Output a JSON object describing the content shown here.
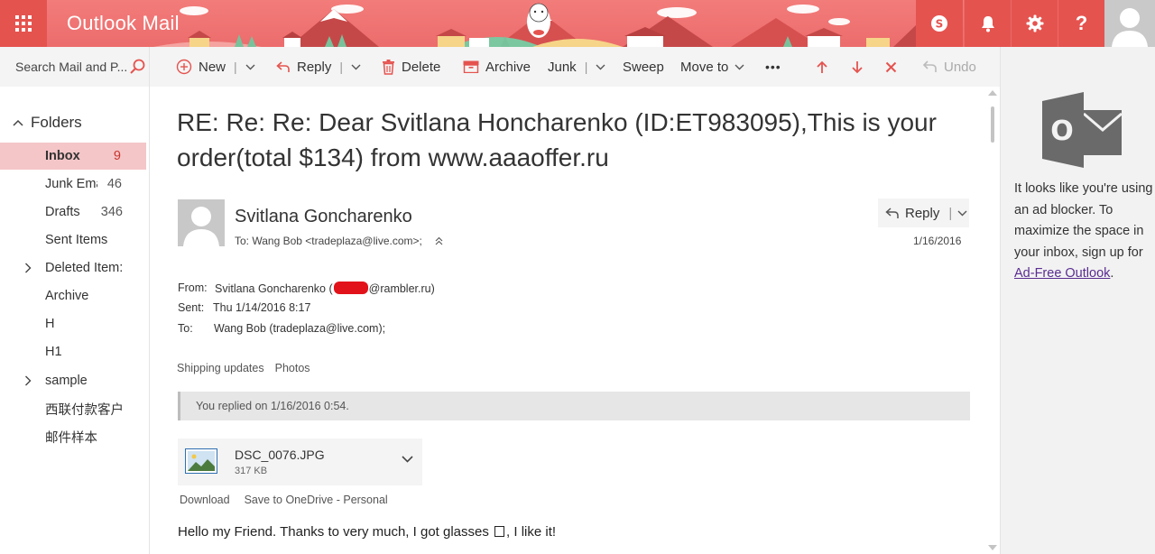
{
  "header": {
    "app_title": "Outlook Mail",
    "brand_color": "#ec6c6c",
    "buttons": [
      "skype-icon",
      "bell-icon",
      "gear-icon",
      "help-icon"
    ],
    "help_glyph": "?"
  },
  "search": {
    "placeholder": "Search Mail and P..."
  },
  "toolbar": {
    "new_label": "New",
    "reply_label": "Reply",
    "delete_label": "Delete",
    "archive_label": "Archive",
    "junk_label": "Junk",
    "sweep_label": "Sweep",
    "move_to_label": "Move to",
    "more_glyph": "•••",
    "undo_label": "Undo",
    "separator": "|"
  },
  "nav": {
    "folders_label": "Folders",
    "folders": [
      {
        "name": "Inbox",
        "count": "9",
        "selected": true
      },
      {
        "name": "Junk Ema",
        "count": "46"
      },
      {
        "name": "Drafts",
        "count": "346"
      },
      {
        "name": "Sent Items",
        "count": ""
      },
      {
        "name": "Deleted Item:",
        "count": "",
        "expandable": true
      },
      {
        "name": "Archive",
        "count": ""
      },
      {
        "name": "H",
        "count": ""
      },
      {
        "name": "H1",
        "count": ""
      },
      {
        "name": "sample",
        "count": "",
        "expandable": true
      },
      {
        "name": "西联付款客户",
        "count": ""
      },
      {
        "name": "邮件样本",
        "count": ""
      }
    ]
  },
  "message": {
    "subject_line1": "RE: Re: Re: Dear Svitlana Honcharenko (ID:ET983095),This is your",
    "subject_line2": "order(total $134) from www.aaaoffer.ru",
    "sender_name": "Svitlana Goncharenko",
    "to_line": "To: Wang Bob <tradeplaza@live.com>;",
    "reply_label": "Reply",
    "date": "1/16/2016",
    "meta": {
      "from_key": "From:",
      "from_value_pre": "Svitlana Goncharenko (",
      "from_value_post": "@rambler.ru)",
      "sent_key": "Sent:",
      "sent_value": "Thu 1/14/2016 8:17",
      "to_key": "To:",
      "to_value": "Wang Bob (tradeplaza@live.com);"
    },
    "tags": [
      "Shipping updates",
      "Photos"
    ],
    "replied_notice": "You replied on 1/16/2016 0:54.",
    "attachment": {
      "name": "DSC_0076.JPG",
      "size": "317 KB"
    },
    "attachment_actions": [
      "Download",
      "Save to OneDrive - Personal"
    ],
    "body_pre": "Hello my Friend. Thanks to very much, I got glasses ",
    "body_post": ", I like it!"
  },
  "right_pane": {
    "ad_text": "It looks like you're using an ad blocker. To maximize the space in your inbox, sign up for ",
    "ad_link": "Ad-Free Outlook",
    "ad_period": ".",
    "logo_letter": "O"
  }
}
